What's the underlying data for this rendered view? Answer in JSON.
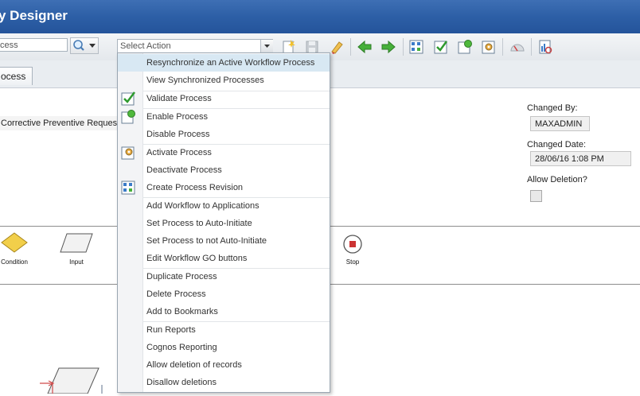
{
  "header": {
    "title": "y Designer"
  },
  "toolbar": {
    "search_value": "cess",
    "select_action_placeholder": "Select Action"
  },
  "tab": {
    "label": "ocess"
  },
  "record": {
    "description_value": "Corrective Preventive Request",
    "changed_by_label": "Changed By:",
    "changed_by_value": "MAXADMIN",
    "changed_date_label": "Changed Date:",
    "changed_date_value": "28/06/16 1:08 PM",
    "allow_deletion_label": "Allow Deletion?"
  },
  "palette": {
    "condition_label": "Condition",
    "input_label": "Input",
    "stop_label": "Stop"
  },
  "menu": {
    "items": [
      "Resynchronize an Active Workflow Process",
      "View Synchronized Processes",
      "Validate Process",
      "Enable Process",
      "Disable Process",
      "Activate Process",
      "Deactivate Process",
      "Create Process Revision",
      "Add Workflow to Applications",
      "Set Process to Auto-Initiate",
      "Set Process to not Auto-Initiate",
      "Edit Workflow GO buttons",
      "Duplicate Process",
      "Delete Process",
      "Add to Bookmarks",
      "Run Reports",
      "Cognos Reporting",
      "Allow deletion of records",
      "Disallow deletions"
    ]
  },
  "colors": {
    "header": "#2d5fa6",
    "menu_highlight": "#d8e8f3",
    "stop": "#cc3333",
    "condition": "#f2cf4a"
  }
}
